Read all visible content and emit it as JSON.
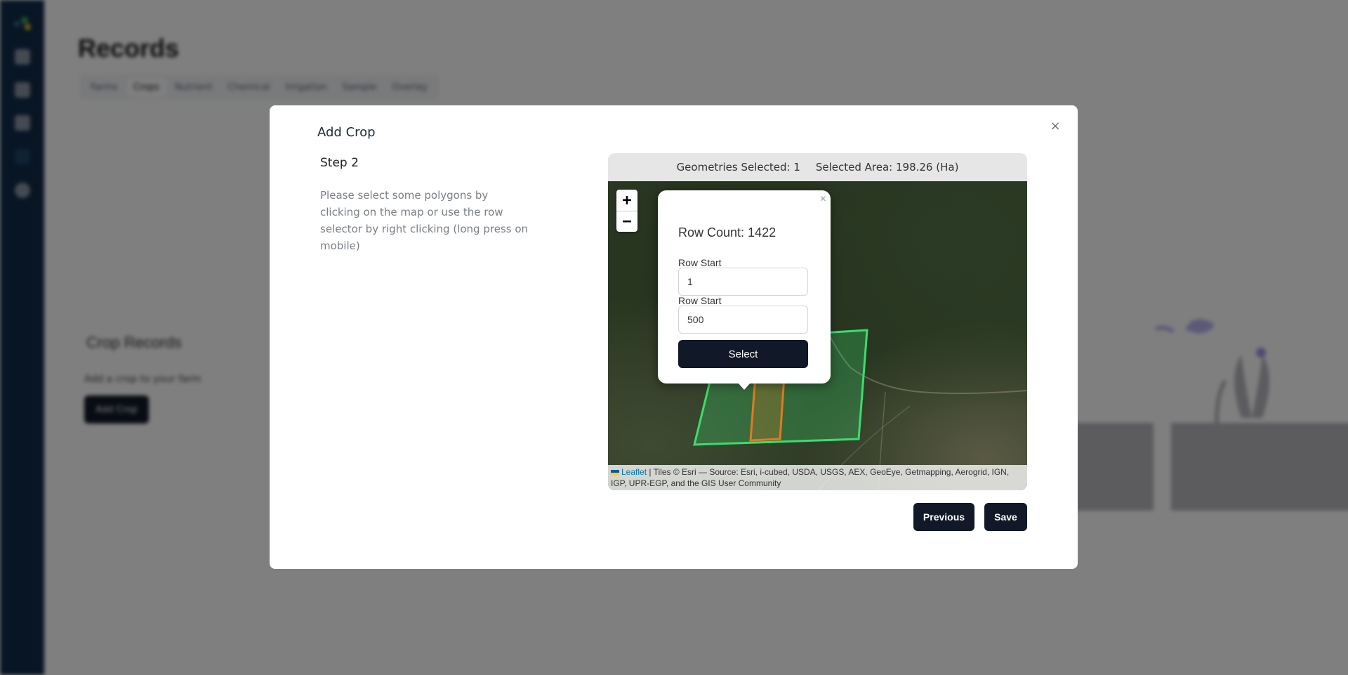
{
  "app": {
    "page_title": "Records",
    "tabs": [
      {
        "label": "Farms",
        "active": false
      },
      {
        "label": "Crops",
        "active": true
      },
      {
        "label": "Nutrient",
        "active": false
      },
      {
        "label": "Chemical",
        "active": false
      },
      {
        "label": "Irrigation",
        "active": false
      },
      {
        "label": "Sample",
        "active": false
      },
      {
        "label": "Overlay",
        "active": false
      }
    ],
    "sidebar_icons": [
      "dashboard-icon",
      "records-icon",
      "reports-icon",
      "folder-icon",
      "settings-icon"
    ],
    "crop_records": {
      "heading": "Crop Records",
      "subtitle": "Add a crop to your farm",
      "button": "Add Crop"
    }
  },
  "modal": {
    "title": "Add Crop",
    "close_icon": "×",
    "step": "Step 2",
    "description": "Please select some polygons by clicking on the map or use the row selector by right clicking (long press on mobile)",
    "map": {
      "geometries_selected_label": "Geometries Selected: 1",
      "selected_area_label": "Selected Area: 198.26 (Ha)",
      "zoom_in": "+",
      "zoom_out": "−",
      "popup": {
        "close": "×",
        "row_count": "Row Count: 1422",
        "field1_label": "Row Start",
        "field1_value": "1",
        "field2_label": "Row Start",
        "field2_value": "500",
        "select_button": "Select"
      },
      "attribution": {
        "leaflet": "Leaflet",
        "text": " | Tiles © Esri — Source: Esri, i-cubed, USDA, USGS, AEX, GeoEye, Getmapping, Aerogrid, IGN, IGP, UPR-EGP, and the GIS User Community"
      },
      "colors": {
        "field_outline": "#3ddc6e",
        "selected_row_outline": "#e07b22"
      }
    },
    "previous_button": "Previous",
    "save_button": "Save"
  }
}
